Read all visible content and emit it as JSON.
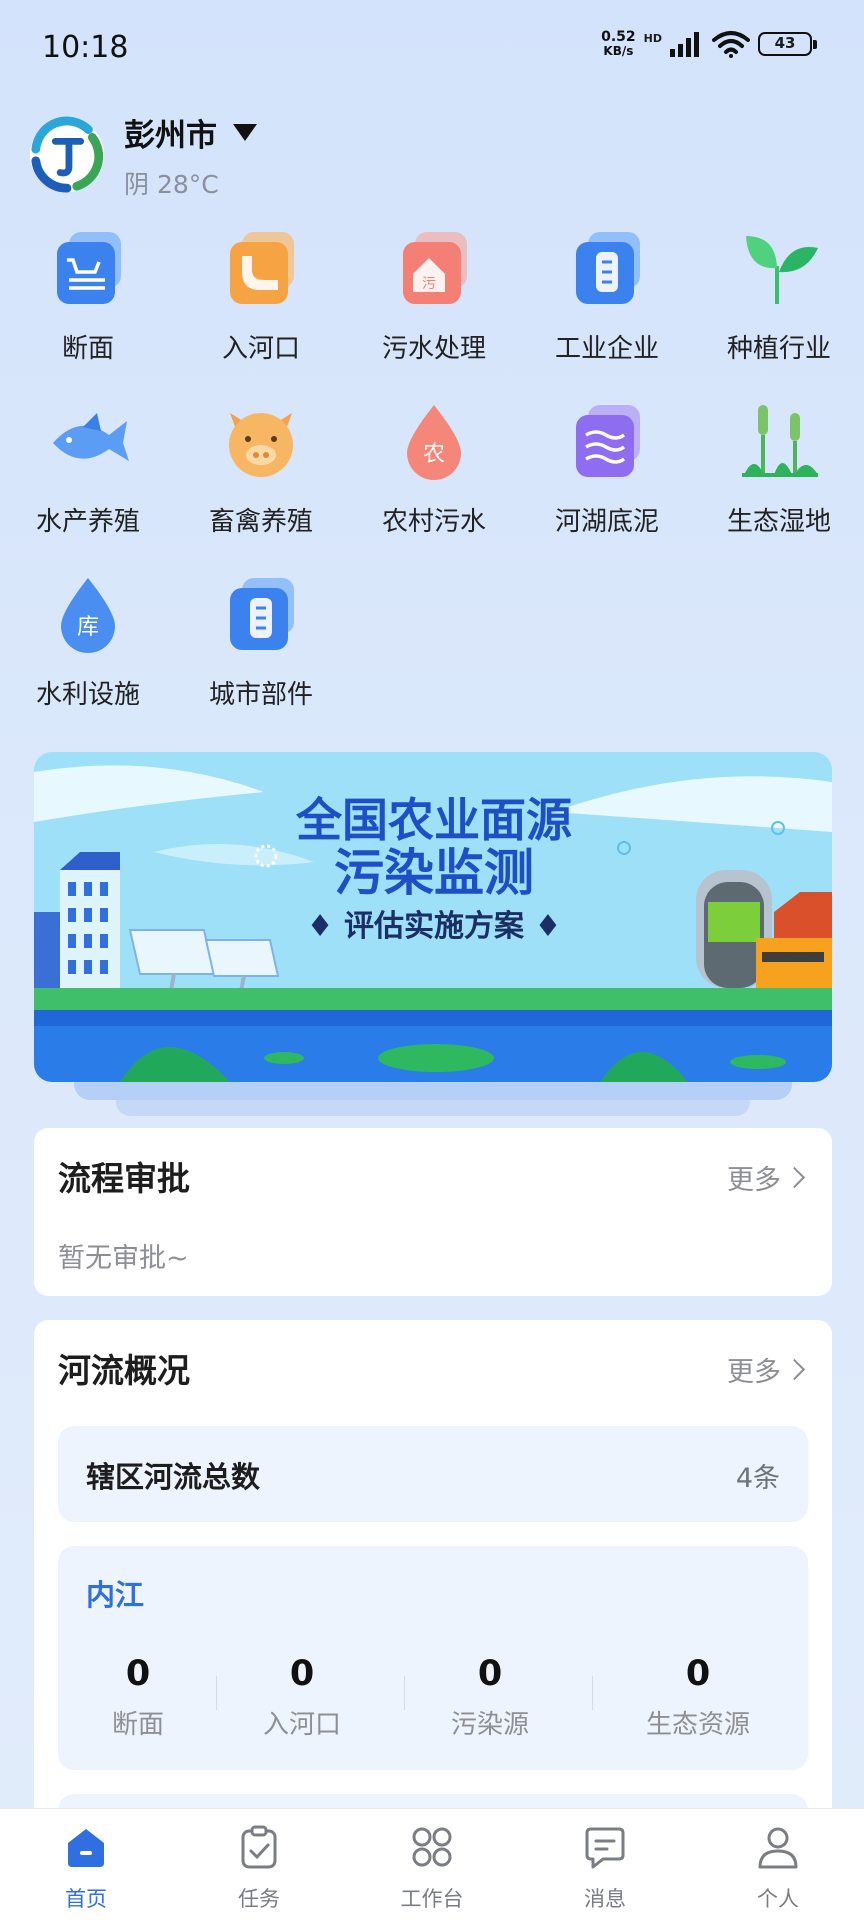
{
  "status_bar": {
    "time": "10:18",
    "net_speed_value": "0.52",
    "net_speed_unit": "KB/s",
    "hd": "HD",
    "battery": "43"
  },
  "header": {
    "city": "彭州市",
    "weather": "阴 28°C"
  },
  "grid": {
    "items": [
      {
        "label": "断面",
        "icon": "cross-section-icon"
      },
      {
        "label": "入河口",
        "icon": "river-outlet-icon"
      },
      {
        "label": "污水处理",
        "icon": "sewage-treatment-icon"
      },
      {
        "label": "工业企业",
        "icon": "industrial-enterprise-icon"
      },
      {
        "label": "种植行业",
        "icon": "sprout-icon"
      },
      {
        "label": "水产养殖",
        "icon": "fish-icon"
      },
      {
        "label": "畜禽养殖",
        "icon": "pig-icon"
      },
      {
        "label": "农村污水",
        "icon": "rural-sewage-drop-icon"
      },
      {
        "label": "河湖底泥",
        "icon": "sediment-icon"
      },
      {
        "label": "生态湿地",
        "icon": "wetland-reeds-icon"
      },
      {
        "label": "水利设施",
        "icon": "reservoir-drop-icon"
      },
      {
        "label": "城市部件",
        "icon": "city-component-icon"
      }
    ],
    "drop_char_rural": "农",
    "drop_char_reservoir": "库",
    "house_char": "污"
  },
  "banner": {
    "line1": "全国农业面源",
    "line2": "污染监测",
    "line3": "♦ 评估实施方案 ♦"
  },
  "approval": {
    "title": "流程审批",
    "more": "更多",
    "empty": "暂无审批~"
  },
  "river": {
    "title": "河流概况",
    "more": "更多",
    "summary_label": "辖区河流总数",
    "summary_value": "4条",
    "rivers": [
      {
        "name": "内江",
        "stats": [
          {
            "value": "0",
            "label": "断面"
          },
          {
            "value": "0",
            "label": "入河口"
          },
          {
            "value": "0",
            "label": "污染源"
          },
          {
            "value": "0",
            "label": "生态资源"
          }
        ]
      }
    ]
  },
  "tabbar": {
    "tabs": [
      {
        "label": "首页",
        "icon": "home-icon",
        "active": true
      },
      {
        "label": "任务",
        "icon": "clipboard-icon",
        "active": false
      },
      {
        "label": "工作台",
        "icon": "grid-apps-icon",
        "active": false
      },
      {
        "label": "消息",
        "icon": "message-icon",
        "active": false
      },
      {
        "label": "个人",
        "icon": "person-icon",
        "active": false
      }
    ]
  },
  "colors": {
    "accent": "#2f6fe0",
    "background": "#d8e6fa"
  }
}
